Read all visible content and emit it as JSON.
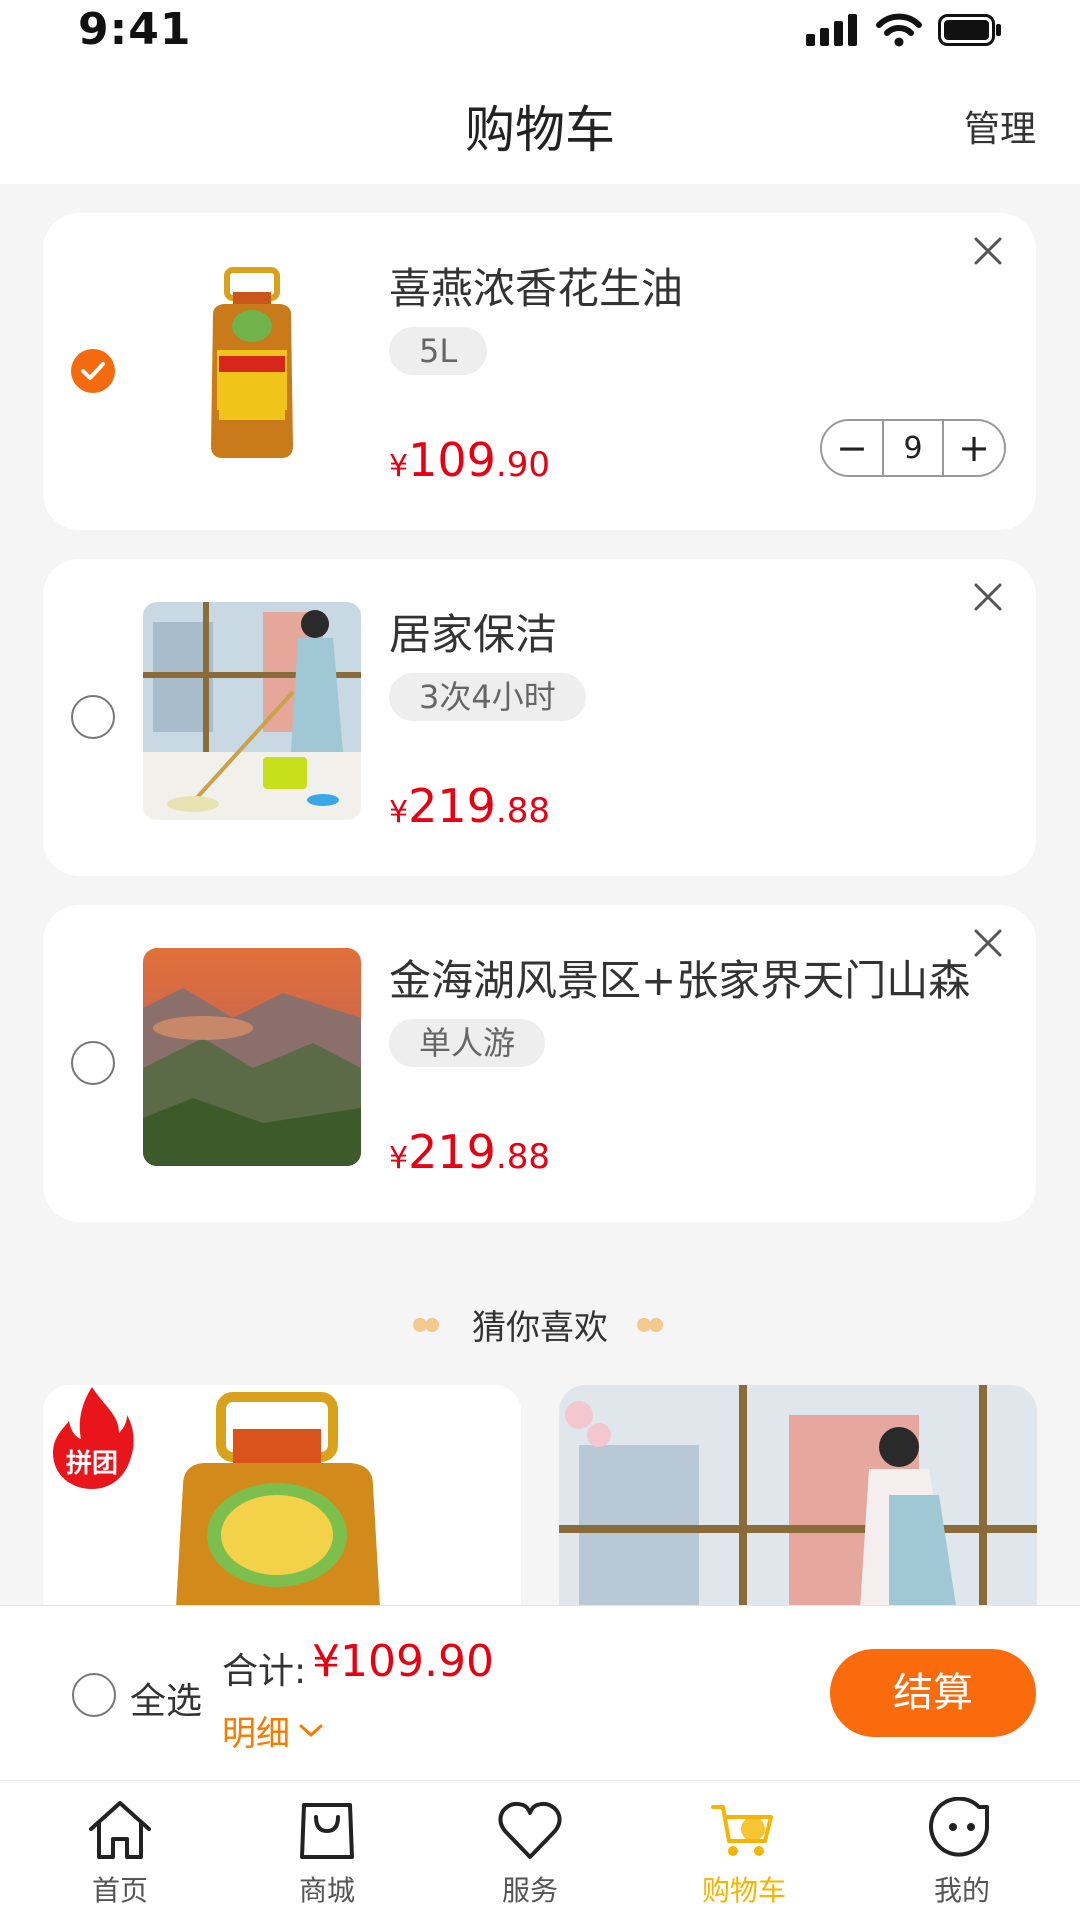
{
  "status_bar": {
    "time": "9:41"
  },
  "nav": {
    "title": "购物车",
    "manage": "管理"
  },
  "cart_items": [
    {
      "title": "喜燕浓香花生油",
      "spec": "5L",
      "price_symbol": "¥",
      "price_int": "109",
      "price_dec": ".90",
      "checked": true,
      "quantity": "9"
    },
    {
      "title": "居家保洁",
      "spec": "3次4小时",
      "price_symbol": "¥",
      "price_int": "219",
      "price_dec": ".88",
      "checked": false
    },
    {
      "title": "金海湖风景区+张家界天门山森",
      "spec": "单人游",
      "price_symbol": "¥",
      "price_int": "219",
      "price_dec": ".88",
      "checked": false
    }
  ],
  "stepper": {
    "minus": "−",
    "plus": "+"
  },
  "recommend": {
    "title": "猜你喜欢",
    "items": [
      {
        "badge": "拼团"
      }
    ]
  },
  "checkout": {
    "select_all": "全选",
    "total_label": "合计:",
    "total_value": "¥109.90",
    "detail": "明细",
    "button": "结算"
  },
  "tabs": [
    {
      "label": "首页",
      "icon": "home-icon"
    },
    {
      "label": "商城",
      "icon": "shopping-bag-icon"
    },
    {
      "label": "服务",
      "icon": "heart-icon"
    },
    {
      "label": "购物车",
      "icon": "cart-icon",
      "active": true
    },
    {
      "label": "我的",
      "icon": "smiley-icon"
    }
  ],
  "colors": {
    "accent": "#f96b0c",
    "price": "#e60012",
    "tab_active": "#f7b500"
  }
}
